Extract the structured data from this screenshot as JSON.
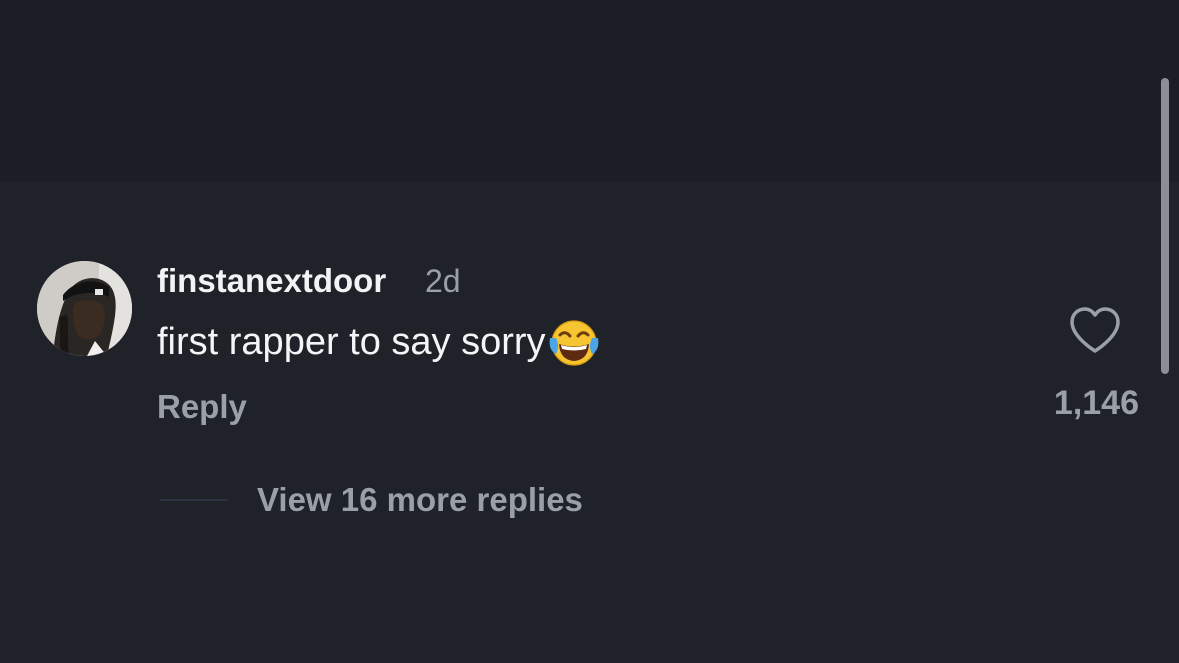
{
  "comment": {
    "username": "finstanextdoor",
    "timestamp": "2d",
    "text": "first rapper to say sorry",
    "emoji": "face-with-tears-of-joy",
    "reply_label": "Reply",
    "like_count": "1,146",
    "view_replies_label": "View 16 more replies"
  },
  "icons": {
    "like": "heart-outline-icon",
    "emoji": "face-with-tears-of-joy-icon"
  },
  "colors": {
    "background": "#1f2228",
    "top_band": "#1b1e24",
    "primary_text": "#f2f3f5",
    "secondary_text": "#9aa0a8",
    "scrollbar": "#8b8f95"
  }
}
